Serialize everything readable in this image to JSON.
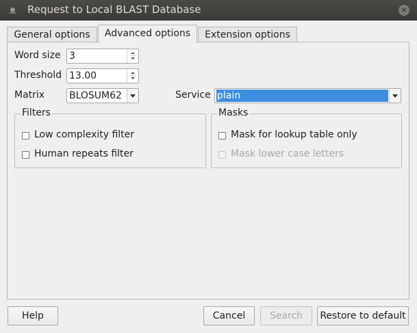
{
  "window": {
    "title": "Request to Local BLAST Database",
    "close_glyph": "×"
  },
  "tabs": [
    {
      "label": "General options",
      "active": false
    },
    {
      "label": "Advanced options",
      "active": true
    },
    {
      "label": "Extension options",
      "active": false
    }
  ],
  "fields": {
    "word_size": {
      "label": "Word size",
      "value": "3"
    },
    "threshold": {
      "label": "Threshold",
      "value": "13.00"
    },
    "matrix": {
      "label": "Matrix",
      "value": "BLOSUM62"
    },
    "service": {
      "label": "Service",
      "value": "plain"
    }
  },
  "filters": {
    "title": "Filters",
    "items": [
      {
        "label": "Low complexity filter",
        "checked": false,
        "enabled": true
      },
      {
        "label": "Human repeats filter",
        "checked": false,
        "enabled": true
      }
    ]
  },
  "masks": {
    "title": "Masks",
    "items": [
      {
        "label": "Mask for lookup table only",
        "checked": false,
        "enabled": true
      },
      {
        "label": "Mask lower case letters",
        "checked": false,
        "enabled": false
      }
    ]
  },
  "buttons": {
    "help": "Help",
    "cancel": "Cancel",
    "search": "Search",
    "restore": "Restore to default"
  },
  "colors": {
    "selection": "#3d8ee0",
    "titlebar": "#3f3e3a"
  }
}
